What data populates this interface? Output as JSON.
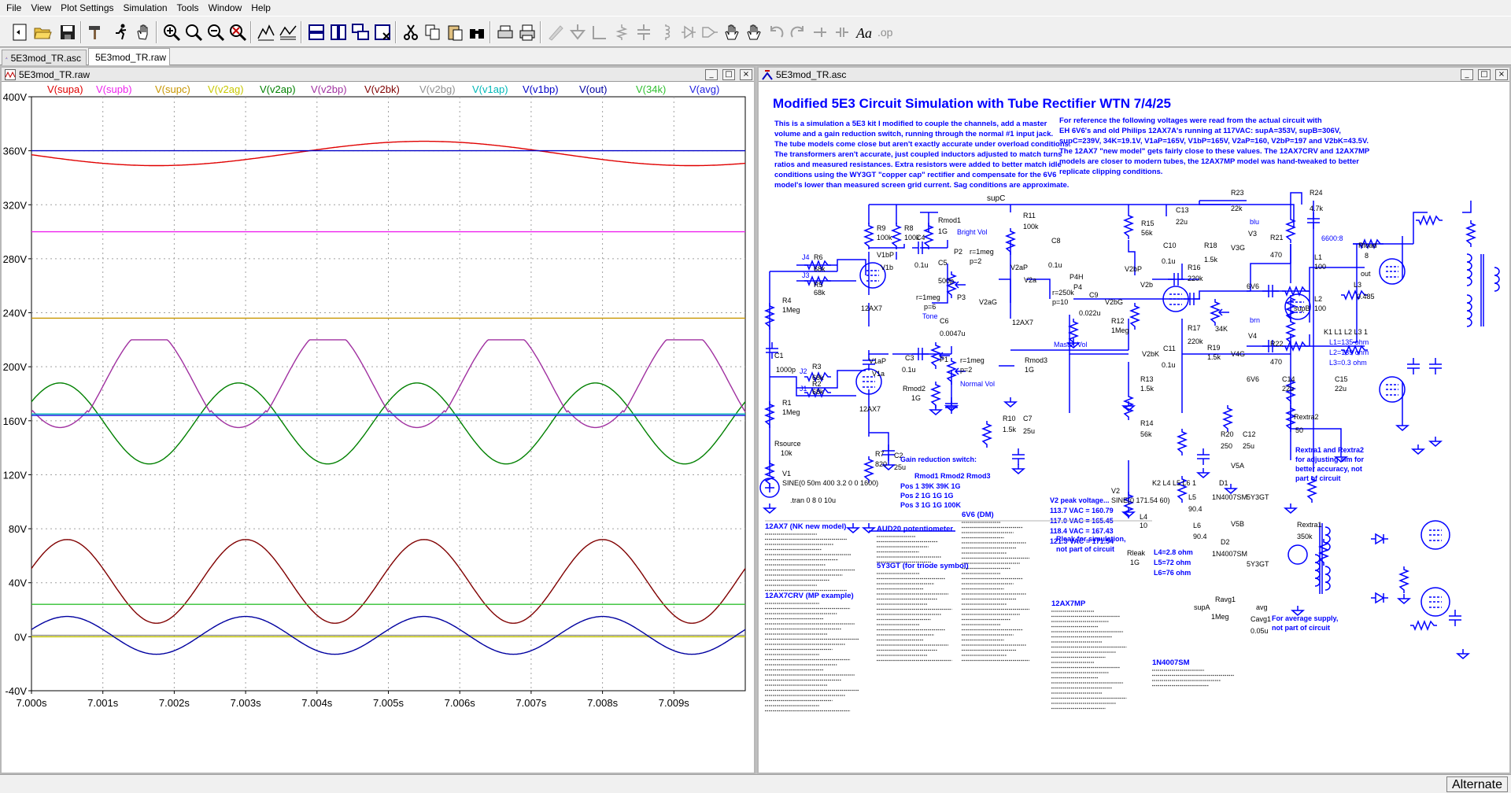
{
  "menu": [
    "File",
    "View",
    "Plot Settings",
    "Simulation",
    "Tools",
    "Window",
    "Help"
  ],
  "tabs": [
    {
      "label": "5E3mod_TR.asc",
      "icon": "schematic-icon"
    },
    {
      "label": "5E3mod_TR.raw",
      "icon": "waveform-icon"
    }
  ],
  "plot_window": {
    "title": "5E3mod_TR.raw"
  },
  "schematic_window": {
    "title": "5E3mod_TR.asc"
  },
  "status": {
    "mode": "Alternate"
  },
  "colors": {
    "supa": "#e00000",
    "supb": "#ee22ee",
    "supc": "#c89600",
    "v2ag": "#c8c800",
    "v2ap": "#008000",
    "v2bp": "#a030a0",
    "v2bk": "#800000",
    "v2bg": "#909090",
    "v1ap": "#00b8b8",
    "v1bp": "#0000c8",
    "out": "#0000a0",
    "34k": "#30c030",
    "avg": "#2020e0",
    "schematic_text": "#0000ff",
    "wire": "#0000ff"
  },
  "chart_data": {
    "type": "line",
    "title": "",
    "xlabel": "",
    "ylabel": "",
    "xlim": [
      7.0,
      7.01
    ],
    "ylim": [
      -40,
      400
    ],
    "grid": true,
    "legend": "top",
    "x_ticks": [
      "7.000s",
      "7.001s",
      "7.002s",
      "7.003s",
      "7.004s",
      "7.005s",
      "7.006s",
      "7.007s",
      "7.008s",
      "7.009s"
    ],
    "y_ticks": [
      "400V",
      "360V",
      "320V",
      "280V",
      "240V",
      "200V",
      "160V",
      "120V",
      "80V",
      "40V",
      "0V",
      "-40V"
    ],
    "series": [
      {
        "name": "V(supa)",
        "color_key": "supa",
        "shape": "sine",
        "center": 358,
        "amplitude": 9,
        "period": 0.0075,
        "peak_at": 7.0055,
        "min_dip": 7.002
      },
      {
        "name": "V(supb)",
        "color_key": "supb",
        "shape": "flat",
        "value": 300
      },
      {
        "name": "V(supc)",
        "color_key": "supc",
        "shape": "flat",
        "value": 236
      },
      {
        "name": "V(v2ag)",
        "color_key": "v2ag",
        "shape": "flat",
        "value": 0
      },
      {
        "name": "V(v2ap)",
        "color_key": "v2ap",
        "shape": "sine",
        "center": 158,
        "amplitude": 30,
        "period": 0.0025,
        "peak_at": 7.0004
      },
      {
        "name": "V(v2bp)",
        "color_key": "v2bp",
        "shape": "clipped",
        "center": 188,
        "amplitude": 32,
        "period": 0.0025,
        "peak_at": 7.00165,
        "trough": 155
      },
      {
        "name": "V(v2bk)",
        "color_key": "v2bk",
        "shape": "sine",
        "center": 41,
        "amplitude": 31,
        "period": 0.0025,
        "peak_at": 7.0005
      },
      {
        "name": "V(v2bg)",
        "color_key": "v2bg",
        "shape": "flat",
        "value": 1
      },
      {
        "name": "V(v1ap)",
        "color_key": "v1ap",
        "shape": "flat",
        "value": 165
      },
      {
        "name": "V(v1bp)",
        "color_key": "v1bp",
        "shape": "flat",
        "value": 360
      },
      {
        "name": "V(out)",
        "color_key": "out",
        "shape": "sine",
        "center": 1,
        "amplitude": 14,
        "period": 0.0025,
        "peak_at": 7.0005
      },
      {
        "name": "V(34k)",
        "color_key": "34k",
        "shape": "flat",
        "value": 24
      },
      {
        "name": "V(avg)",
        "color_key": "avg",
        "shape": "flat",
        "value": 164
      }
    ]
  },
  "schematic": {
    "title": "Modified 5E3 Circuit Simulation with Tube Rectifier  WTN 7/4/25",
    "intro": [
      "This is a simulation a 5E3 kit I modified to couple the channels, add a master",
      "volume and a gain reduction switch, running through the normal #1 input jack.",
      "The tube models come close but aren't exactly accurate under overload conditions.",
      "The transformers aren't accurate, just coupled inductors adjusted to match turns",
      "ratios and measured resistances. Extra resistors were added to better match idle",
      "conditions using the WY3GT \"copper cap\" rectifier and compensate for the 6V6",
      "model's lower than measured screen grid current. Sag conditions are approximate."
    ],
    "reference": [
      "For reference the following voltages were read from the actual circuit with",
      "EH 6V6's and old Philips 12AX7A's running at 117VAC: supA=353V, supB=306V,",
      "supC=239V, 34K=19.1V, V1aP=165V, V1bP=165V, V2aP=160, V2bP=197 and V2bK=43.5V.",
      "The 12AX7 \"new model\" gets fairly close to these values. The 12AX7CRV and 12AX7MP",
      "models are closer to modern tubes, the 12AX7MP model was hand-tweaked to better",
      "replicate clipping conditions."
    ],
    "gain_switch": {
      "title": "Gain reduction switch:",
      "header": "Rmod1  Rmod2  Rmod3",
      "rows": [
        "Pos 1  39K   39K    1G",
        "Pos 2  1G    1G     1G",
        "Pos 3  1G    1G     100K"
      ]
    },
    "labels": {
      "supC": "supC",
      "R9": "R9",
      "R9v": "100k",
      "R8": "R8",
      "R8v": "100k",
      "Rmod1": "Rmod1",
      "Rmod1v": "1G",
      "BrightVol": "Bright Vol",
      "P2": "P2",
      "C4": "C4",
      "C4v": "0.1u",
      "C5": "C5",
      "C5v": "500p",
      "p1meg": "r=1meg",
      "p2": "p=2",
      "V1bP": "V1bP",
      "V1b": "V1b",
      "J4": "J4",
      "R6": "R6",
      "R6v": "68k",
      "J3": "J3",
      "R5": "R5",
      "R5v": "68k",
      "R4": "R4",
      "R4v": "1Meg",
      "tube12ax7": "12AX7",
      "P3": "P3",
      "p3r": "r=1meg",
      "p3p": "p=6",
      "Tone": "Tone",
      "C6": "C6",
      "C6v": "0.0047u",
      "V2aG": "V2aG",
      "R11": "R11",
      "R11v": "100k",
      "C8": "C8",
      "C8v": "0.1u",
      "V2aP": "V2aP",
      "V2a": "V2a",
      "P4H": "P4H",
      "P4": "P4",
      "p4r": "r=250k",
      "p4p": "p=10",
      "C9": "C9",
      "C9v": "0.022u",
      "MasterVol": "Master Vol",
      "V2bG": "V2bG",
      "R12": "R12",
      "R12v": "1Meg",
      "R15": "R15",
      "R15v": "56k",
      "C13": "C13",
      "C13v": "22u",
      "V2bP": "V2bP",
      "V2b": "V2b",
      "C10": "C10",
      "C10v": "0.1u",
      "R16": "R16",
      "R16v": "220k",
      "R18": "R18",
      "R18v": "1.5k",
      "V3G": "V3G",
      "V3": "V3",
      "blu": "blu",
      "R23": "R23",
      "R23v": "22k",
      "R24": "R24",
      "R24v": "4.7k",
      "R21": "R21",
      "R21v": "470",
      "tube6v6": "6V6",
      "ratio": "6600:8",
      "Rload": "Rload",
      "Rloadv": "8",
      "outlbl": "out",
      "L1": "L1",
      "L1v": "100",
      "L2": "L2",
      "L2v": "100",
      "L3": "L3",
      "L3v": "0.485",
      "supB": "supB",
      "K1": "K1 L1 L2 L3 1",
      "L1o": "L1=135 ohm",
      "L2o": "L2=139 ohm",
      "L3o": "L3=0.3 ohm",
      "brn": "brn",
      "R17": "R17",
      "R17v": "220k",
      "V2bK": "V2bK",
      "C11": "C11",
      "C11v": "0.1u",
      "R19": "R19",
      "R19v": "1.5k",
      "V4G": "V4G",
      "V4": "V4",
      "R22": "R22",
      "R22v": "470",
      "C14": "C14",
      "C14v": "22u",
      "C15": "C15",
      "C15v": "22u",
      "34K": "34K",
      "R13": "R13",
      "R13v": "1.5k",
      "R14": "R14",
      "R14v": "56k",
      "R20": "R20",
      "R20v": "250",
      "C12": "C12",
      "C12v": "25u",
      "Rextra2": "Rextra2",
      "Rextra2v": "50",
      "extra_note": "Rextra1 and Rextra2",
      "extra_note2": "for adjusting sim for",
      "extra_note3": "better accuracy, not",
      "extra_note4": "part of circuit",
      "C1": "C1",
      "C1v": "1000p",
      "J2": "J2",
      "R3": "R3",
      "R3v": "68k",
      "J1": "J1",
      "R2": "R2",
      "R2v": "68k",
      "R1": "R1",
      "R1v": "1Meg",
      "V1aP": "V1aP",
      "V1a": "V1a",
      "C3": "C3",
      "C3v": "0.1u",
      "P1": "P1",
      "NormalVol": "Normal Vol",
      "Rmod2": "Rmod2",
      "Rmod2v": "1G",
      "Rmod3": "Rmod3",
      "Rmod3v": "1G",
      "R10": "R10",
      "R10v": "1.5k",
      "C7": "C7",
      "C7v": "25u",
      "R7": "R7",
      "R7v": "820",
      "C2": "C2",
      "C2v": "25u",
      "Rsource": "Rsource",
      "Rsourcev": "10k",
      "V1": "V1",
      "V1v": "SINE(0 50m 400 3.2 0 0 1600)",
      "tran": ".tran 0 8 0 10u",
      "V2": "V2",
      "V2v": "SINE(0 171.54 60)",
      "K2": "K2 L4 L5 L6 1",
      "D1": "D1",
      "V5A": "V5A",
      "L5": "L5",
      "L5v": "90.4",
      "L4": "L4",
      "L4v": "10",
      "L6": "L6",
      "L6v": "90.4",
      "D2": "D2",
      "V5B": "V5B",
      "diode": "1N4007SM",
      "tube5y3": "5Y3GT",
      "L4o": "L4=2.8 ohm",
      "L5o": "L5=72 ohm",
      "L6o": "L6=76 ohm",
      "Rleak": "Rleak",
      "Rleakv": "1G",
      "rleak_note": "Rleak for simulation,",
      "rleak_note2": "not part of circuit",
      "Rextra1": "Rextra1",
      "Rextra1v": "350k",
      "supA": "supA",
      "Ravg1": "Ravg1",
      "Ravg1v": "1Meg",
      "avg": "avg",
      "Cavg1": "Cavg1",
      "Cavg1v": "0.05u",
      "avg_note": "For average supply,",
      "avg_note2": "not part of circuit",
      "peak_title": "V2 peak voltage...",
      "peak1": "113.7 VAC = 160.79",
      "peak2": "117.0 VAC = 165.45",
      "peak3": "118.4 VAC = 167.43",
      "peak4": "121.3 VAC = 171.54"
    },
    "models": {
      "m12ax7": "12AX7    (NK new model)",
      "aud20": "AUD20 potentiometer",
      "m6v6": "6V6    (DM)",
      "m5y3": "5Y3GT (for triode symbol)",
      "m12ax7crv": "12AX7CRV (MP example)",
      "m12ax7mp": "12AX7MP",
      "m1n4007": "1N4007SM"
    }
  }
}
